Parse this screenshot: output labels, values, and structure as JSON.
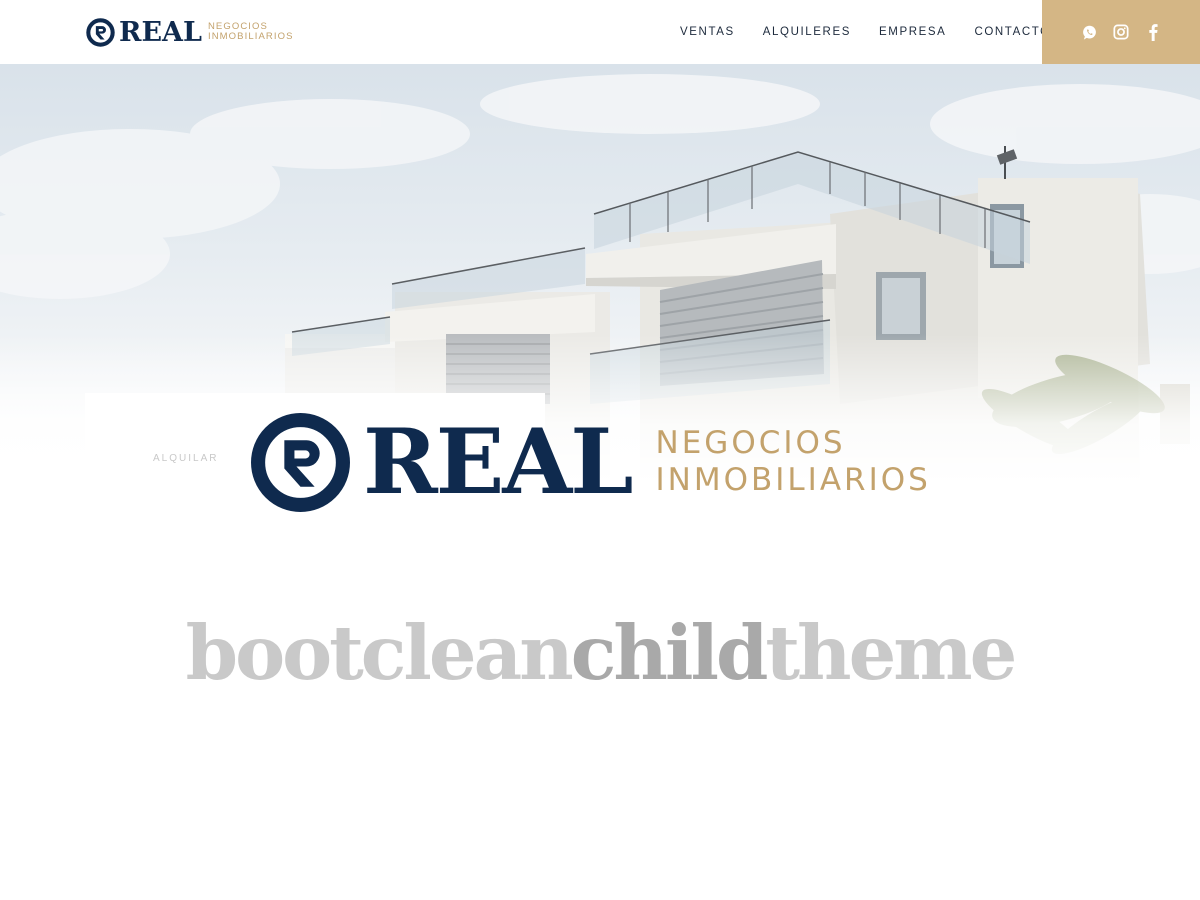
{
  "header": {
    "logo": {
      "word": "REAL",
      "tag_line1": "NEGOCIOS",
      "tag_line2": "INMOBILIARIOS"
    },
    "nav": [
      {
        "label": "VENTAS"
      },
      {
        "label": "ALQUILERES"
      },
      {
        "label": "EMPRESA"
      },
      {
        "label": "CONTACTO"
      }
    ],
    "social": [
      {
        "icon": "whatsapp-icon"
      },
      {
        "icon": "instagram-icon"
      },
      {
        "icon": "facebook-icon"
      }
    ]
  },
  "hero": {
    "search_tab": "ALQUILAR"
  },
  "overlay_logo": {
    "word": "REAL",
    "tag_line1": "NEGOCIOS",
    "tag_line2": "INMOBILIARIOS"
  },
  "theme": {
    "part1": "bootclean",
    "part2": "child",
    "part3": "theme"
  },
  "colors": {
    "navy": "#0f2a4e",
    "gold": "#c3a26c",
    "social_bar": "#d4b685",
    "theme_light": "#c9c9c9",
    "theme_dark": "#a9a9a9"
  }
}
